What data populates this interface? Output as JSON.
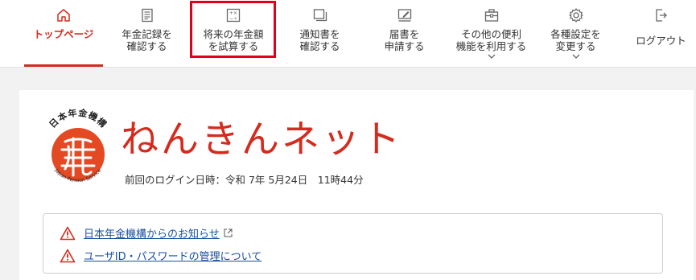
{
  "nav": {
    "items": [
      {
        "label": "トップページ",
        "icon": "home-icon"
      },
      {
        "label": "年金記録を\n確認する",
        "icon": "record-book-icon"
      },
      {
        "label": "将来の年金額\nを試算する",
        "icon": "calculator-icon"
      },
      {
        "label": "通知書を\n確認する",
        "icon": "documents-icon"
      },
      {
        "label": "届書を\n申請する",
        "icon": "form-edit-icon"
      },
      {
        "label": "その他の便利\n機能を利用する",
        "icon": "toolbox-icon"
      },
      {
        "label": "各種設定を\n変更する",
        "icon": "gear-icon"
      },
      {
        "label": "ログアウト",
        "icon": "logout-icon"
      }
    ]
  },
  "logo": {
    "org_name_ja": "日本年金機構",
    "org_name_en": "Japan Pension Service"
  },
  "brand": {
    "title": "ねんきんネット"
  },
  "last_login": "前回のログイン日時：令和 7年 5月24日　11時44分",
  "notices": [
    {
      "text": "日本年金機構からのお知らせ",
      "external": true
    },
    {
      "text": "ユーザID・パスワードの管理について",
      "external": false
    }
  ],
  "colors": {
    "accent": "#d52b1e",
    "link": "#1a4fa0",
    "highlight": "#e0001a"
  }
}
